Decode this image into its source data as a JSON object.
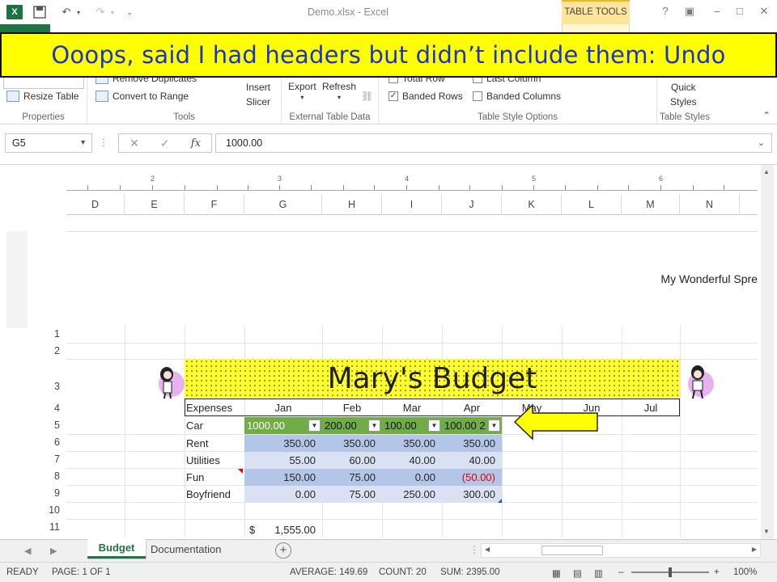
{
  "window": {
    "title": "Demo.xlsx - Excel",
    "contextual_tab_group": "TABLE TOOLS"
  },
  "banner": {
    "text": "Ooops, said I had headers but didn’t include them: Undo"
  },
  "ribbon": {
    "properties": {
      "resize_label": "Resize Table",
      "group_label": "Properties"
    },
    "tools": {
      "remove_duplicates": "Remove Duplicates",
      "convert_label": "Convert to Range",
      "insert_slicer_line1": "Insert",
      "insert_slicer_line2": "Slicer",
      "group_label": "Tools"
    },
    "external": {
      "export_label": "Export",
      "refresh_label": "Refresh",
      "group_label": "External Table Data"
    },
    "style_options": {
      "total_row": "Total Row",
      "last_column": "Last Column",
      "banded_rows": "Banded Rows",
      "banded_columns": "Banded Columns",
      "group_label": "Table Style Options"
    },
    "table_styles": {
      "quick_line1": "Quick",
      "quick_line2": "Styles",
      "group_label": "Table Styles"
    }
  },
  "formula_bar": {
    "name_box": "G5",
    "fx": "fx",
    "value": "1000.00"
  },
  "columns": [
    "D",
    "E",
    "F",
    "G",
    "H",
    "I",
    "J",
    "K",
    "L",
    "M",
    "N"
  ],
  "ruler_numbers": [
    "2",
    "3",
    "4",
    "5",
    "6"
  ],
  "page_header": "My Wonderful Spre",
  "rows": [
    "1",
    "2",
    "3",
    "4",
    "5",
    "6",
    "7",
    "8",
    "9",
    "10",
    "11"
  ],
  "sheet": {
    "title": "Mary's Budget",
    "header_row": [
      "Expenses",
      "Jan",
      "Feb",
      "Mar",
      "Apr",
      "May",
      "Jun",
      "Jul"
    ],
    "car_row": {
      "label": "Car",
      "values": [
        "1000.00",
        "200.00",
        "100.00",
        "100.00 2"
      ]
    },
    "data_rows": [
      {
        "label": "Rent",
        "values": [
          "350.00",
          "350.00",
          "350.00",
          "350.00"
        ]
      },
      {
        "label": "Utilities",
        "values": [
          "55.00",
          "60.00",
          "40.00",
          "40.00"
        ]
      },
      {
        "label": "Fun",
        "values": [
          "150.00",
          "75.00",
          "0.00",
          "(50.00)"
        ]
      },
      {
        "label": "Boyfriend",
        "values": [
          "0.00",
          "75.00",
          "250.00",
          "300.00"
        ]
      }
    ],
    "total_currency": "$",
    "total_value": "1,555.00"
  },
  "tabs": {
    "active": "Budget",
    "other": "Documentation"
  },
  "status": {
    "mode": "READY",
    "page": "PAGE: 1 OF 1",
    "average": "AVERAGE: 149.69",
    "count": "COUNT: 20",
    "sum": "SUM: 2395.00",
    "zoom": "100%"
  },
  "colors": {
    "excel_green": "#217346",
    "banner_yellow": "#ffff00",
    "banner_text": "#1c34c8",
    "table_green": "#70ad47",
    "band_dark": "#b4c6e7",
    "band_light": "#d9e1f2"
  }
}
